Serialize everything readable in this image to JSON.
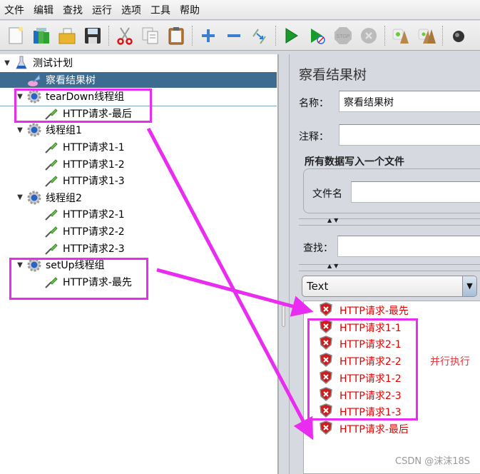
{
  "menubar": {
    "items": [
      "文件",
      "编辑",
      "查找",
      "运行",
      "选项",
      "工具",
      "帮助"
    ]
  },
  "toolbar": {
    "buttons": [
      {
        "name": "new-icon",
        "label": "新建"
      },
      {
        "name": "templates-icon",
        "label": "模板"
      },
      {
        "name": "open-icon",
        "label": "打开"
      },
      {
        "name": "save-icon",
        "label": "保存"
      },
      {
        "name": "cut-icon",
        "label": "剪切"
      },
      {
        "name": "copy-icon",
        "label": "复制"
      },
      {
        "name": "paste-icon",
        "label": "粘贴"
      },
      {
        "name": "expand-icon",
        "label": "+"
      },
      {
        "name": "collapse-icon",
        "label": "−"
      },
      {
        "name": "toggle-icon",
        "label": "切换"
      },
      {
        "name": "start-icon",
        "label": "启动"
      },
      {
        "name": "start-no-pause-icon",
        "label": "不停顿启动"
      },
      {
        "name": "stop-icon",
        "label": "STOP"
      },
      {
        "name": "shutdown-icon",
        "label": "关闭"
      },
      {
        "name": "clear-icon",
        "label": "清除"
      },
      {
        "name": "clear-all-icon",
        "label": "清除全部"
      },
      {
        "name": "search-icon",
        "label": "查找"
      }
    ]
  },
  "tree": {
    "items": [
      {
        "label": "测试计划",
        "type": "test-plan",
        "level": 0,
        "expanded": true
      },
      {
        "label": "察看结果树",
        "type": "listener",
        "level": 1,
        "selected": true
      },
      {
        "label": "tearDown线程组",
        "type": "thread-group",
        "level": 1,
        "expanded": true
      },
      {
        "label": "HTTP请求-最后",
        "type": "sampler",
        "level": 2
      },
      {
        "label": "线程组1",
        "type": "thread-group",
        "level": 1,
        "expanded": true
      },
      {
        "label": "HTTP请求1-1",
        "type": "sampler",
        "level": 2
      },
      {
        "label": "HTTP请求1-2",
        "type": "sampler",
        "level": 2
      },
      {
        "label": "HTTP请求1-3",
        "type": "sampler",
        "level": 2
      },
      {
        "label": "线程组2",
        "type": "thread-group",
        "level": 1,
        "expanded": true
      },
      {
        "label": "HTTP请求2-1",
        "type": "sampler",
        "level": 2
      },
      {
        "label": "HTTP请求2-2",
        "type": "sampler",
        "level": 2
      },
      {
        "label": "HTTP请求2-3",
        "type": "sampler",
        "level": 2
      },
      {
        "label": "setUp线程组",
        "type": "thread-group",
        "level": 1,
        "expanded": true
      },
      {
        "label": "HTTP请求-最先",
        "type": "sampler",
        "level": 2
      }
    ]
  },
  "panel": {
    "title": "察看结果树",
    "name_label": "名称：",
    "name_value": "察看结果树",
    "comment_label": "注释：",
    "comment_value": "",
    "file_group_title": "所有数据写入一个文件",
    "filename_label": "文件名",
    "filename_value": "",
    "search_label": "查找：",
    "search_value": "",
    "renderer_selected": "Text",
    "split_arrows": "▲▼"
  },
  "results": {
    "items": [
      {
        "label": "HTTP请求-最先",
        "status": "error"
      },
      {
        "label": "HTTP请求1-1",
        "status": "error"
      },
      {
        "label": "HTTP请求2-1",
        "status": "error"
      },
      {
        "label": "HTTP请求2-2",
        "status": "error"
      },
      {
        "label": "HTTP请求1-2",
        "status": "error"
      },
      {
        "label": "HTTP请求2-3",
        "status": "error"
      },
      {
        "label": "HTTP请求1-3",
        "status": "error"
      },
      {
        "label": "HTTP请求-最后",
        "status": "error"
      }
    ],
    "error_color": "#e10000"
  },
  "annotations": {
    "parallel_label": "并行执行",
    "color": "#e92cf0"
  },
  "watermark": "CSDN @沫沫18S"
}
